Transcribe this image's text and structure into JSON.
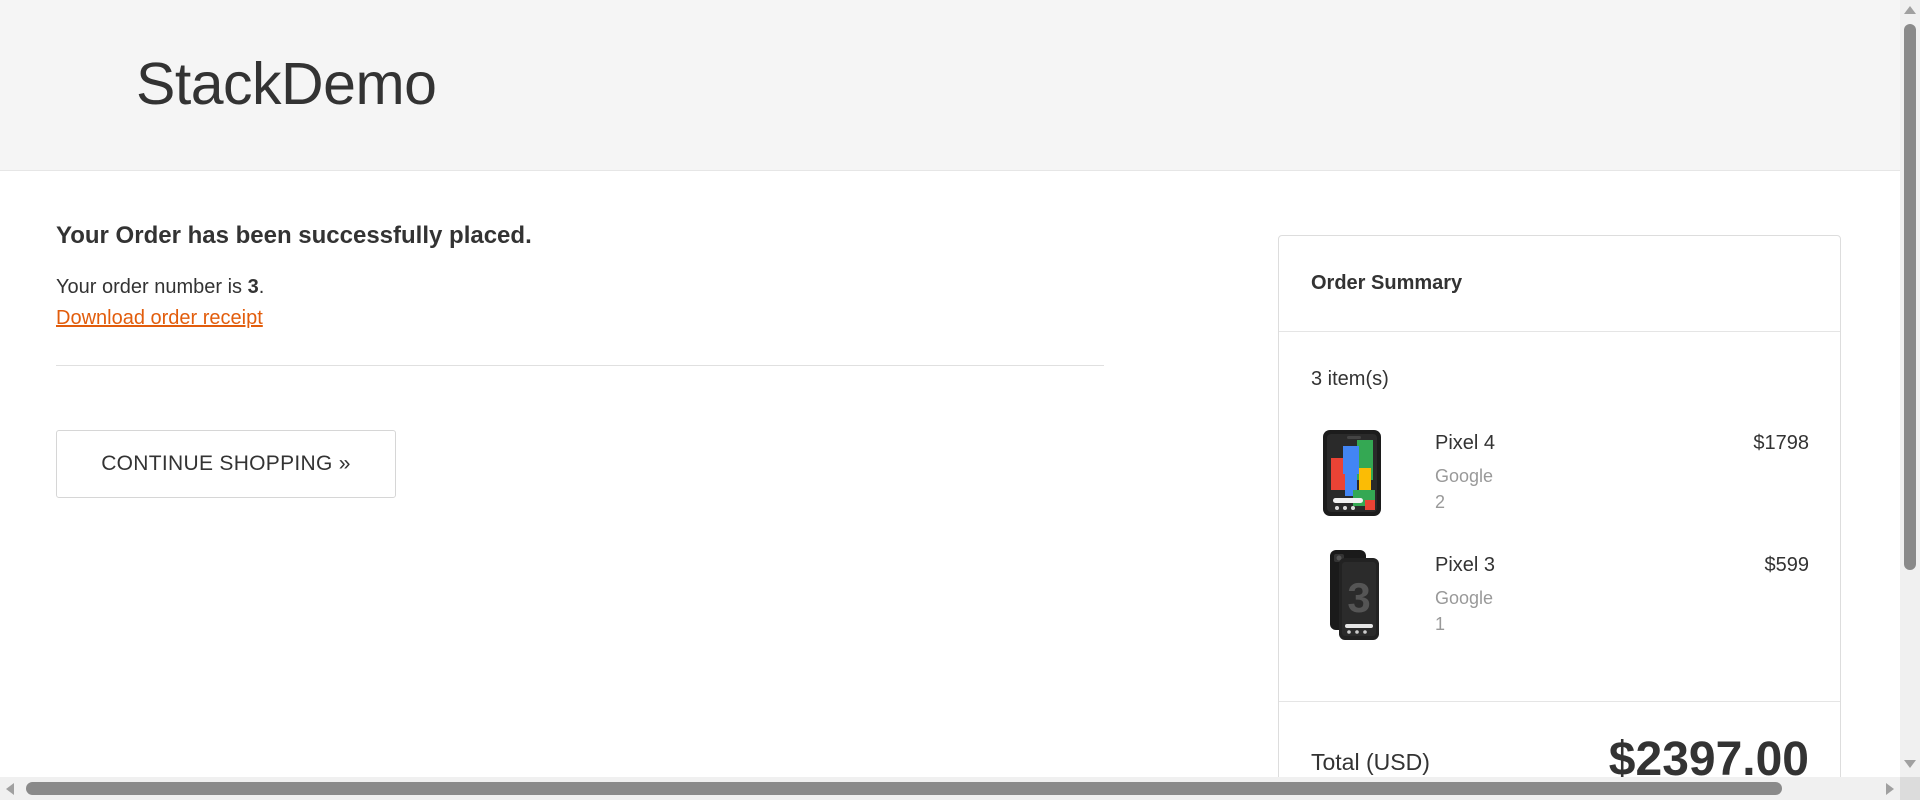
{
  "header": {
    "brand": "StackDemo"
  },
  "confirmation": {
    "title": "Your Order has been successfully placed.",
    "order_number_prefix": "Your order number is ",
    "order_number": "3",
    "order_number_suffix": ".",
    "receipt_link": "Download order receipt",
    "continue_button": "CONTINUE SHOPPING »"
  },
  "order_summary": {
    "title": "Order Summary",
    "items_count": "3 item(s)",
    "items": [
      {
        "name": "Pixel 4",
        "brand": "Google",
        "quantity": "2",
        "price": "$1798",
        "image": "pixel-4-phone-image"
      },
      {
        "name": "Pixel 3",
        "brand": "Google",
        "quantity": "1",
        "price": "$599",
        "image": "pixel-3-phone-image"
      }
    ],
    "total_label": "Total (USD)",
    "total_value": "$2397.00"
  },
  "colors": {
    "header_bg": "#f5f5f5",
    "link": "#e25d0c",
    "text": "#333333",
    "muted": "#999999"
  }
}
